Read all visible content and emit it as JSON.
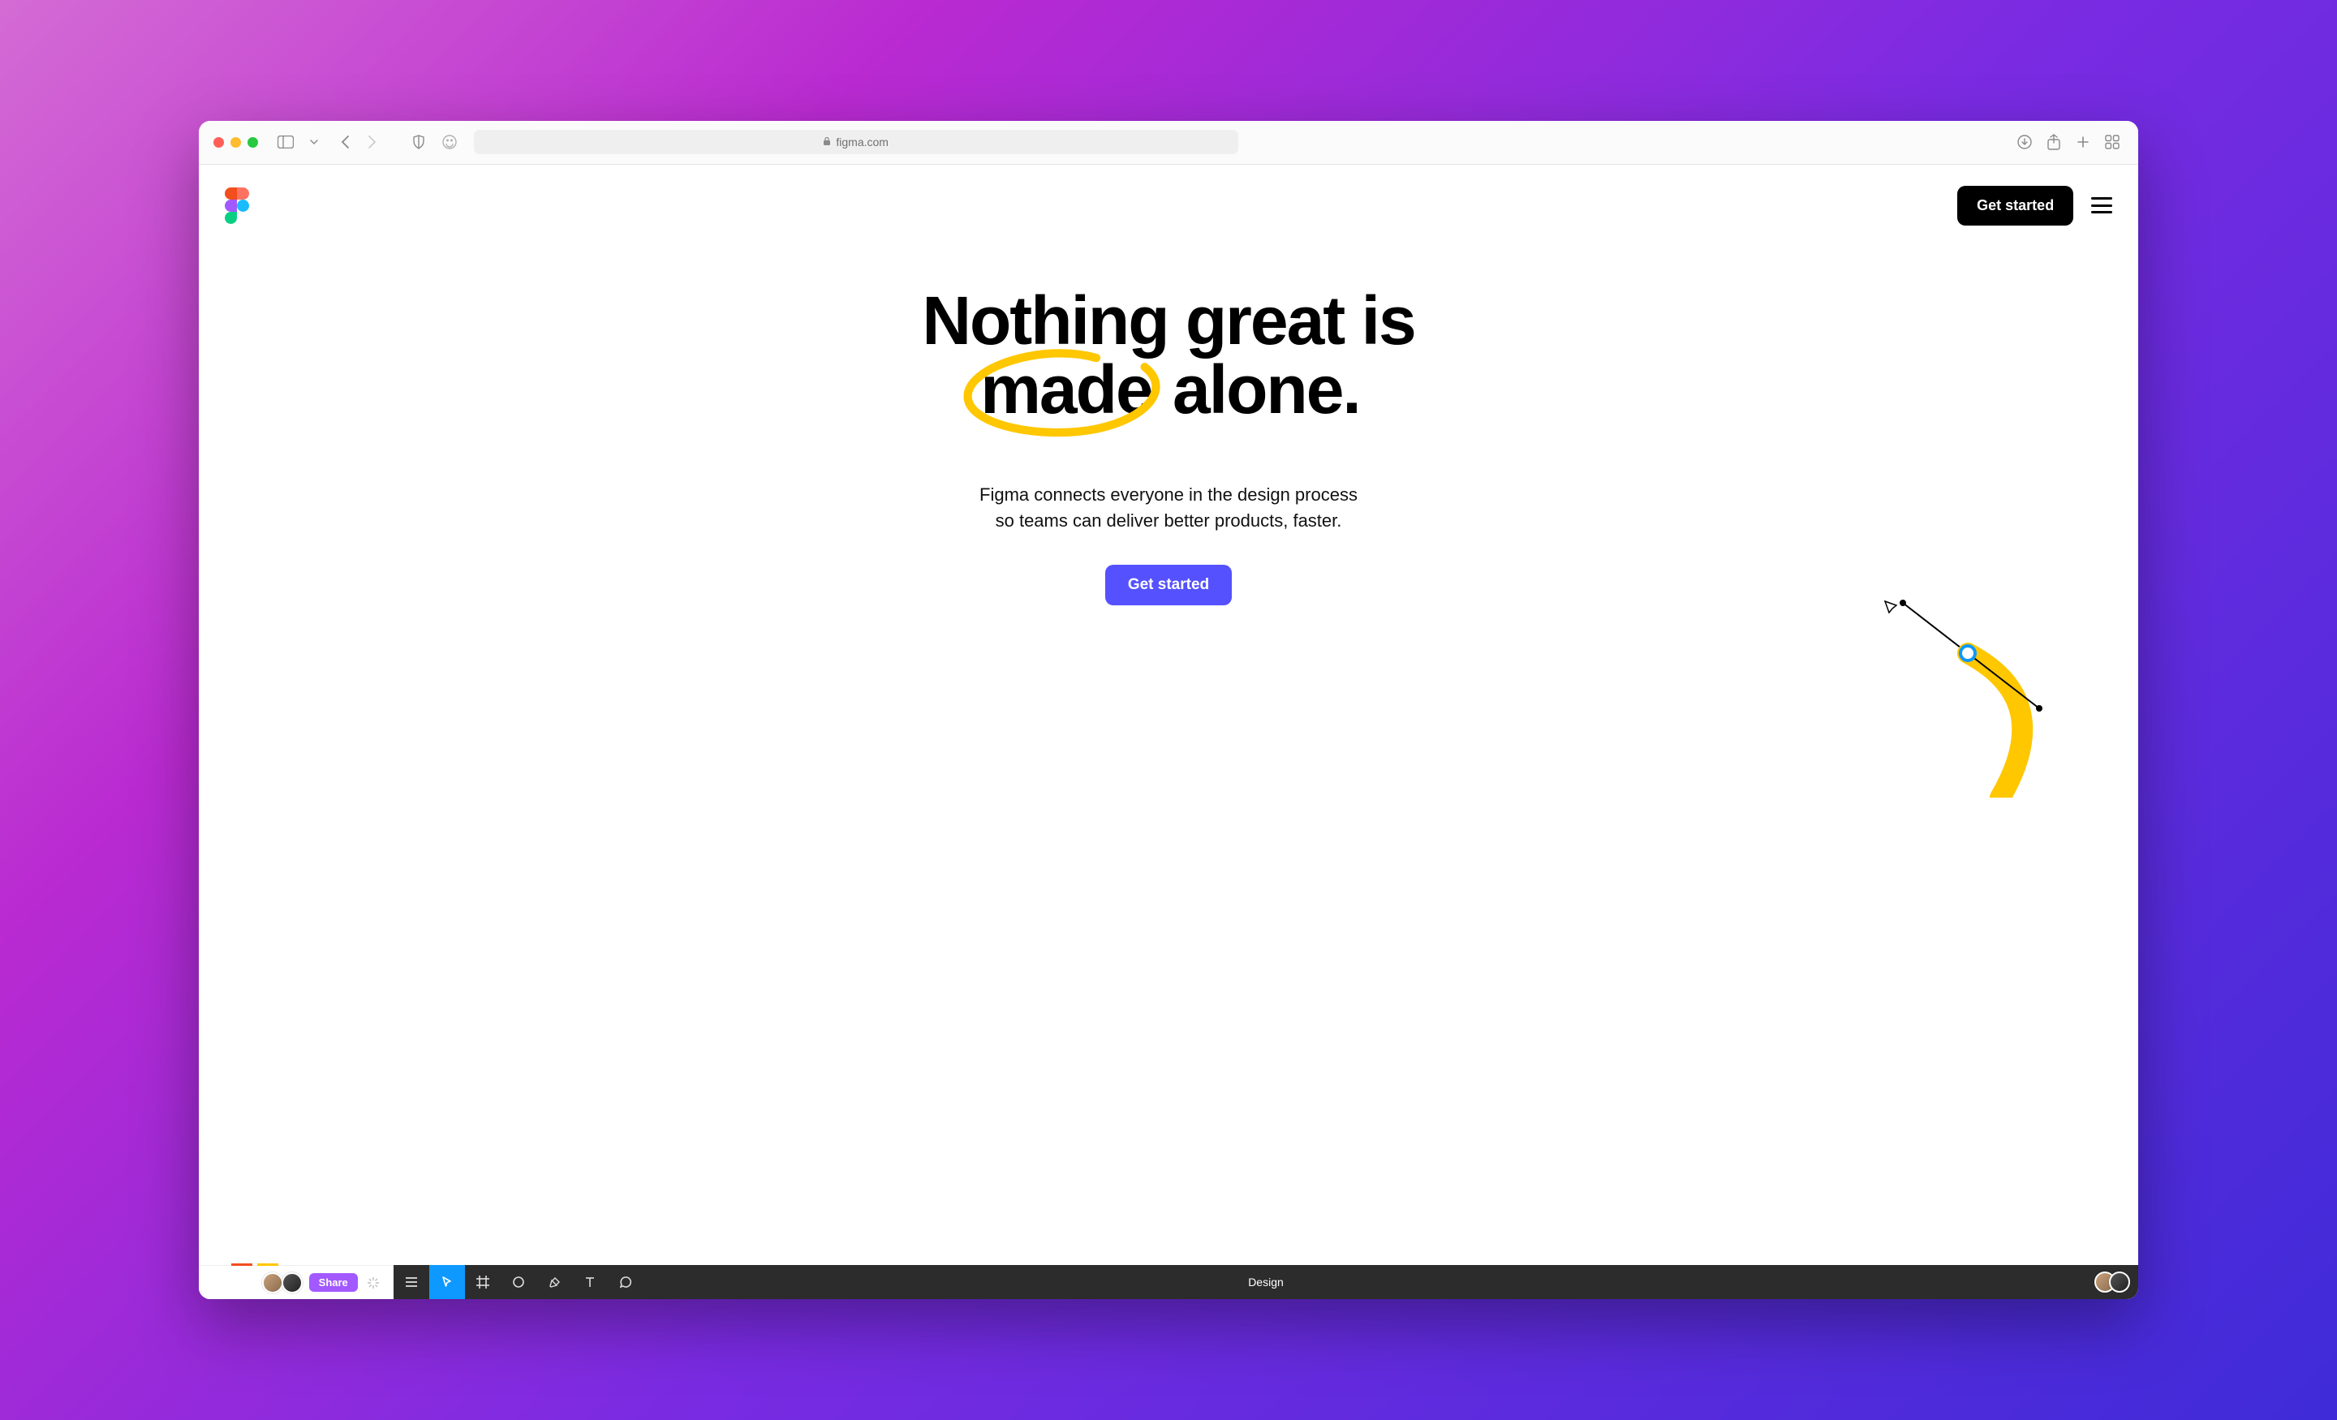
{
  "browser": {
    "url_display": "figma.com"
  },
  "header": {
    "cta_label": "Get started"
  },
  "hero": {
    "headline_line1": "Nothing great is",
    "headline_word_circled": "made",
    "headline_word_after": "alone.",
    "subhead": "Figma connects everyone in the design process\nso teams can deliver better products, faster.",
    "cta_label": "Get started"
  },
  "bottom": {
    "share_label": "Share",
    "mode_label": "Design"
  },
  "colors": {
    "primary": "#5551ff",
    "accent_yellow": "#ffc700",
    "figma_purple": "#a259ff"
  }
}
